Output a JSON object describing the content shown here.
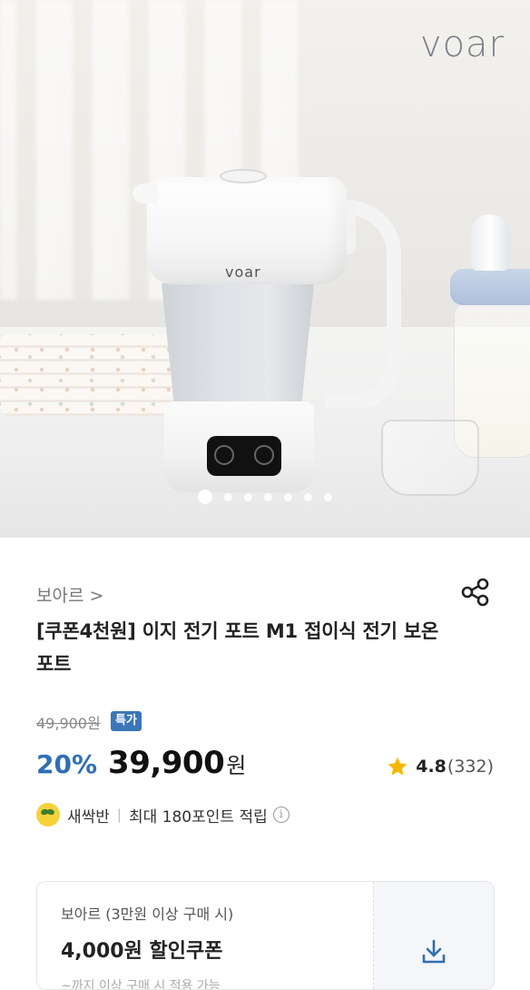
{
  "hero": {
    "brand_watermark": "voar",
    "kettle_logo": "voar",
    "carousel_total": 7,
    "carousel_active": 1
  },
  "product": {
    "seller": "보아르 >",
    "title": "[쿠폰4천원] 이지 전기 포트 M1 접이식 전기 보온 포트",
    "original_price": "49,900원",
    "badge": "특가",
    "discount": "20%",
    "price": "39,900",
    "price_unit": "원",
    "rating": "4.8",
    "review_count": "(332)"
  },
  "points": {
    "grade": "새싹반",
    "separator": "|",
    "text": "최대 180포인트 적립",
    "info_icon": "i"
  },
  "coupon": {
    "condition": "보아르 (3만원 이상 구매 시)",
    "amount": "4,000원 할인쿠폰",
    "sub": "~까지 이상 구매 시 적용 가능"
  },
  "colors": {
    "accent_blue": "#2f6fb4",
    "badge_blue": "#3b76b8",
    "star": "#f5b800"
  },
  "icons": {
    "share": "share-icon",
    "star": "star-icon",
    "download": "download-icon",
    "grade": "sprout-icon",
    "info": "info-icon"
  }
}
